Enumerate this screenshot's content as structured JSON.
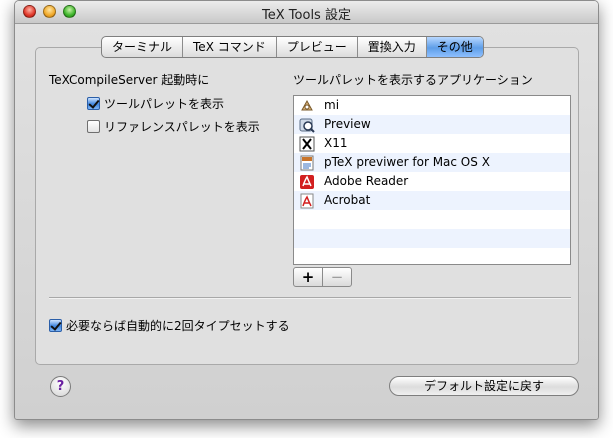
{
  "window": {
    "title": "TeX Tools 設定"
  },
  "tabs": [
    {
      "label": "ターミナル",
      "selected": false
    },
    {
      "label": "TeX コマンド",
      "selected": false
    },
    {
      "label": "プレビュー",
      "selected": false
    },
    {
      "label": "置換入力",
      "selected": false
    },
    {
      "label": "その他",
      "selected": true
    }
  ],
  "left_section": {
    "heading": "TeXCompileServer 起動時に",
    "options": [
      {
        "label": "ツールパレットを表示",
        "checked": true
      },
      {
        "label": "リファレンスパレットを表示",
        "checked": false
      }
    ]
  },
  "right_section": {
    "heading": "ツールパレットを表示するアプリケーション",
    "apps": [
      {
        "name": "mi",
        "icon": "mi-app-icon"
      },
      {
        "name": "Preview",
        "icon": "preview-app-icon"
      },
      {
        "name": "X11",
        "icon": "x11-app-icon"
      },
      {
        "name": "pTeX previwer for Mac OS X",
        "icon": "ptex-previewer-icon"
      },
      {
        "name": "Adobe Reader",
        "icon": "adobe-reader-icon"
      },
      {
        "name": "Acrobat",
        "icon": "acrobat-icon"
      }
    ],
    "add_label": "+",
    "remove_label": "−"
  },
  "bottom_option": {
    "label": "必要ならば自動的に2回タイプセットする",
    "checked": true
  },
  "help_label": "?",
  "restore_button_label": "デフォルト設定に戻す",
  "colors": {
    "selected_tab": "#5e9ee8",
    "alt_row": "#edf3fe"
  }
}
